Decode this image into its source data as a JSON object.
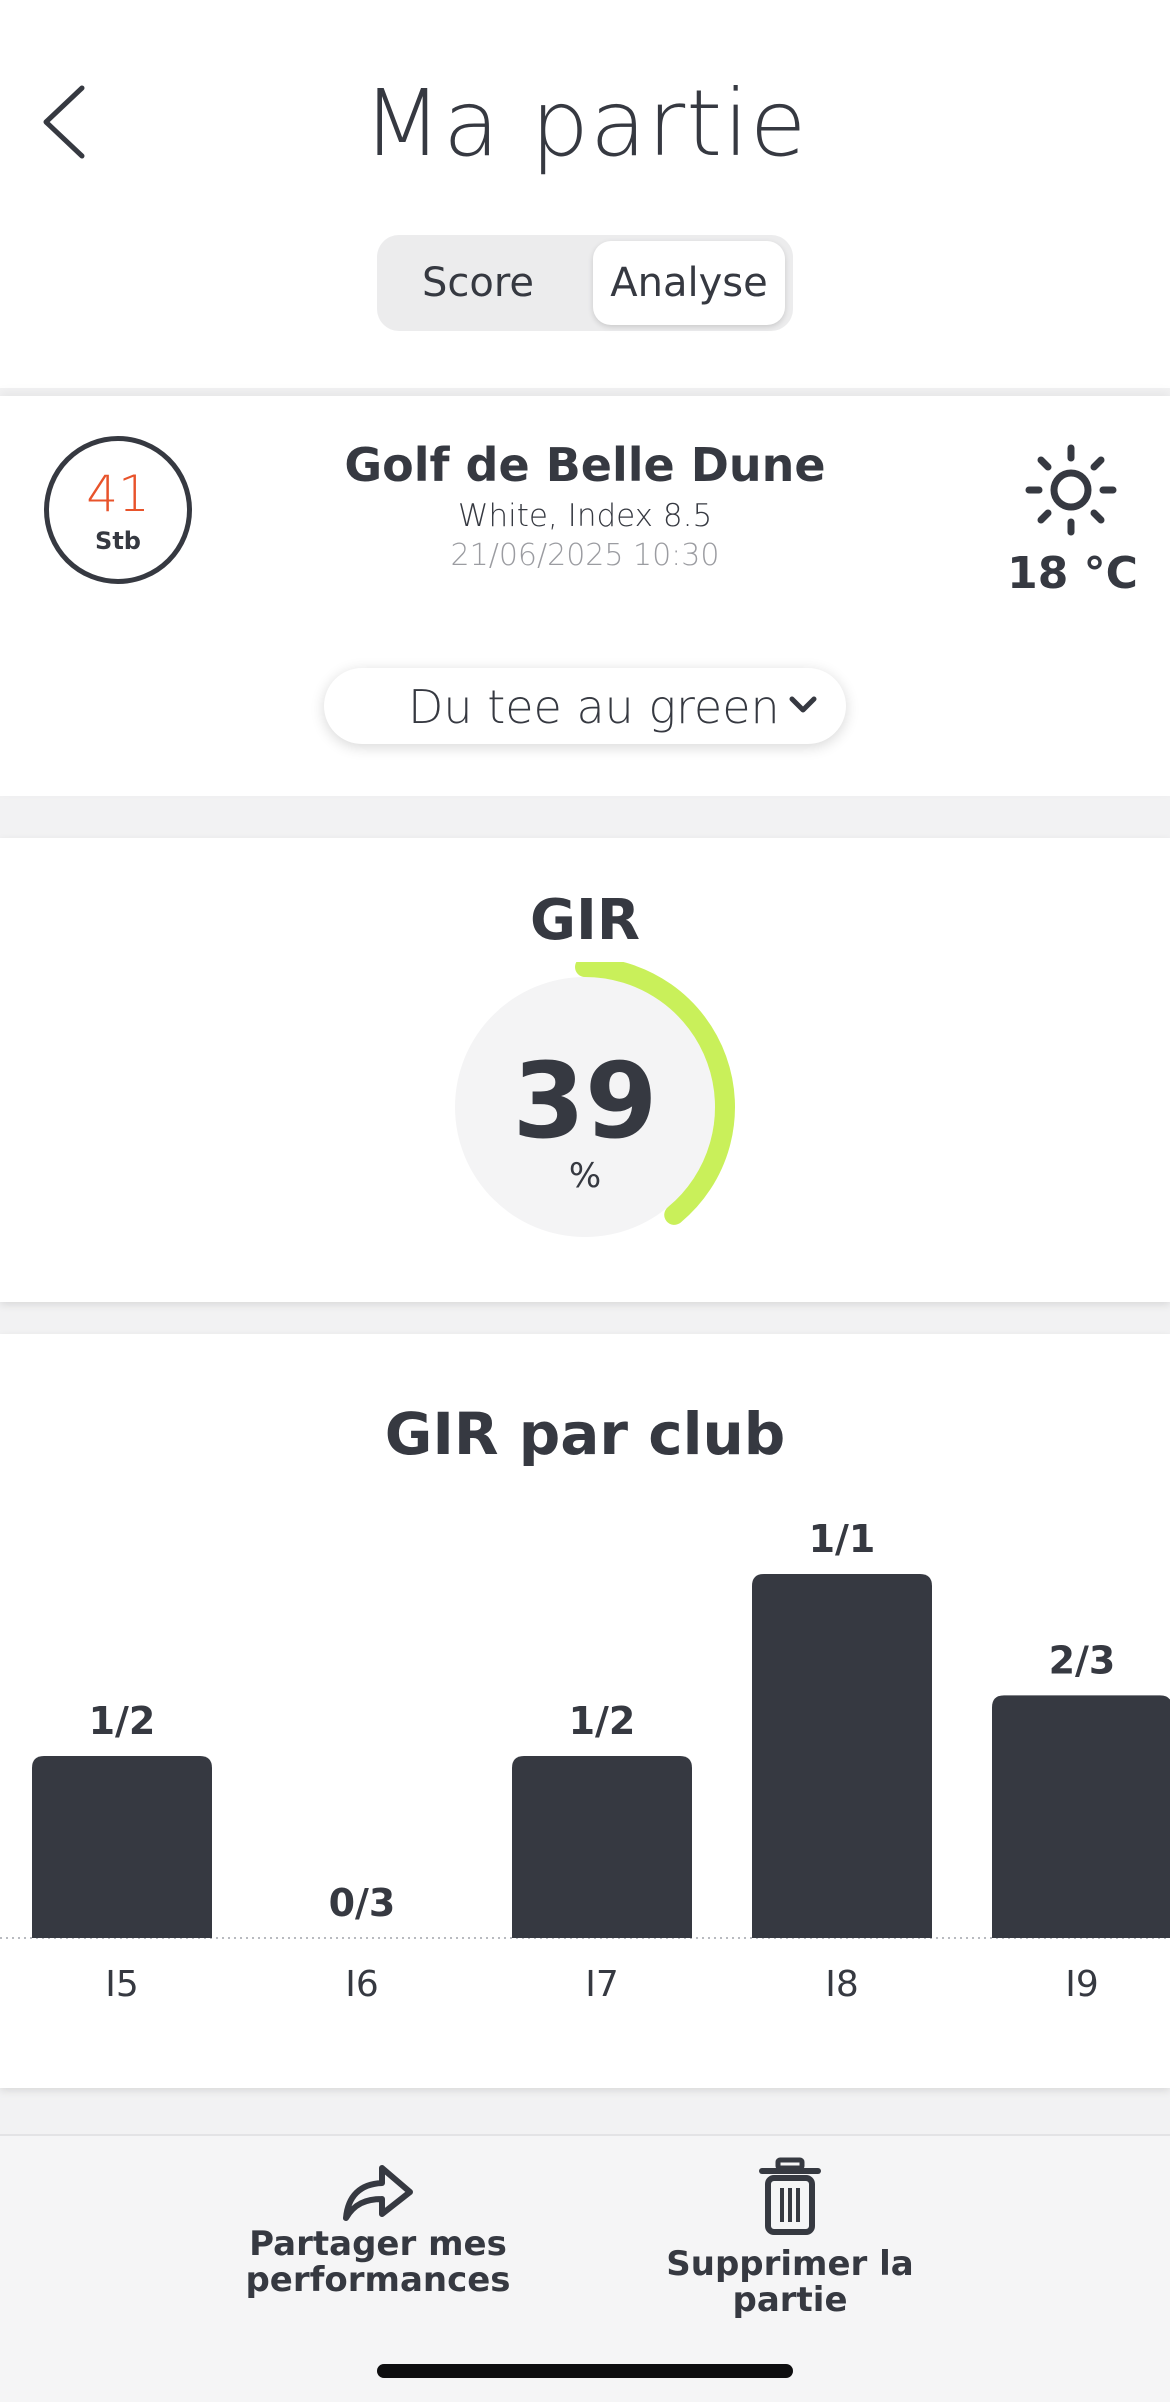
{
  "header": {
    "title": "Ma partie",
    "tabs": [
      {
        "label": "Score",
        "active": false
      },
      {
        "label": "Analyse",
        "active": true
      }
    ]
  },
  "round": {
    "score_value": "41",
    "score_unit": "Stb",
    "course_name": "Golf de Belle Dune",
    "tee_info": "White, Index 8.5",
    "datetime": "21/06/2025 10:30",
    "weather_icon": "sun-icon",
    "temperature": "18 °C",
    "filter": {
      "selected": "Du tee au green"
    }
  },
  "gir": {
    "title": "GIR",
    "value": "39",
    "unit": "%",
    "percent": 39,
    "accent_color": "#c9f05a"
  },
  "club_chart": {
    "title": "GIR par club"
  },
  "chart_data": {
    "type": "bar",
    "title": "GIR par club",
    "categories": [
      "I5",
      "I6",
      "I7",
      "I8",
      "I9"
    ],
    "values": [
      0.5,
      0,
      0.5,
      1,
      0.6667
    ],
    "labels": [
      "1/2",
      "0/3",
      "1/2",
      "1/1",
      "2/3"
    ],
    "ylim": [
      0,
      1
    ],
    "bar_color": "#363941"
  },
  "actions": {
    "share_line1": "Partager mes",
    "share_line2": "performances",
    "delete": "Supprimer la partie"
  },
  "colors": {
    "text": "#363941",
    "score_accent": "#e8532b",
    "gauge_accent": "#c9f05a"
  }
}
